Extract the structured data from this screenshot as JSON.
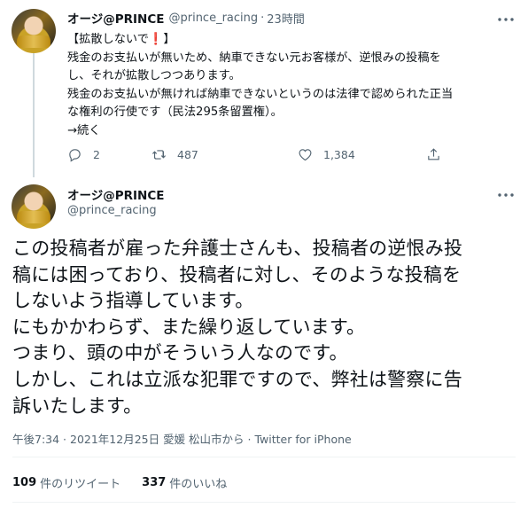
{
  "parent_tweet": {
    "display_name": "オージ@PRINCE",
    "handle": "@prince_racing",
    "separator": "·",
    "time": "23時間",
    "text_lines": [
      "【拡散しないで",
      "❗",
      "】",
      "残金のお支払いが無いため、納車できない元お客様が、逆恨みの投稿を",
      "し、それが拡散しつつあります。",
      "残金のお支払いが無ければ納車できないというのは法律で認められた正当",
      "な権利の行使です（民法295条留置権）。",
      "→続く"
    ],
    "replies": "2",
    "retweets": "487",
    "likes": "1,384",
    "icons": [
      "reply-icon",
      "retweet-icon",
      "like-icon",
      "share-icon",
      "more-icon"
    ]
  },
  "main_tweet": {
    "display_name": "オージ@PRINCE",
    "handle": "@prince_racing",
    "text_lines": [
      "この投稿者が雇った弁護士さんも、投稿者の逆恨み投",
      "稿には困っており、投稿者に対し、そのような投稿を",
      "しないよう指導しています。",
      "にもかかわらず、また繰り返しています。",
      "つまり、頭の中がそういう人なのです。",
      "しかし、これは立派な犯罪ですので、弊社は警察に告",
      "訴いたします。"
    ],
    "meta": "午後7:34 · 2021年12月25日 愛媛 松山市から · Twitter for iPhone",
    "retweet_count": "109",
    "retweet_label": "件のリツイート",
    "like_count": "337",
    "like_label": "件のいいね"
  },
  "colors": {
    "text": "#0f1419",
    "secondary": "#536471",
    "divider": "#eff3f4",
    "thread_line": "#cfd9de",
    "exclamation": "#d0021b"
  }
}
